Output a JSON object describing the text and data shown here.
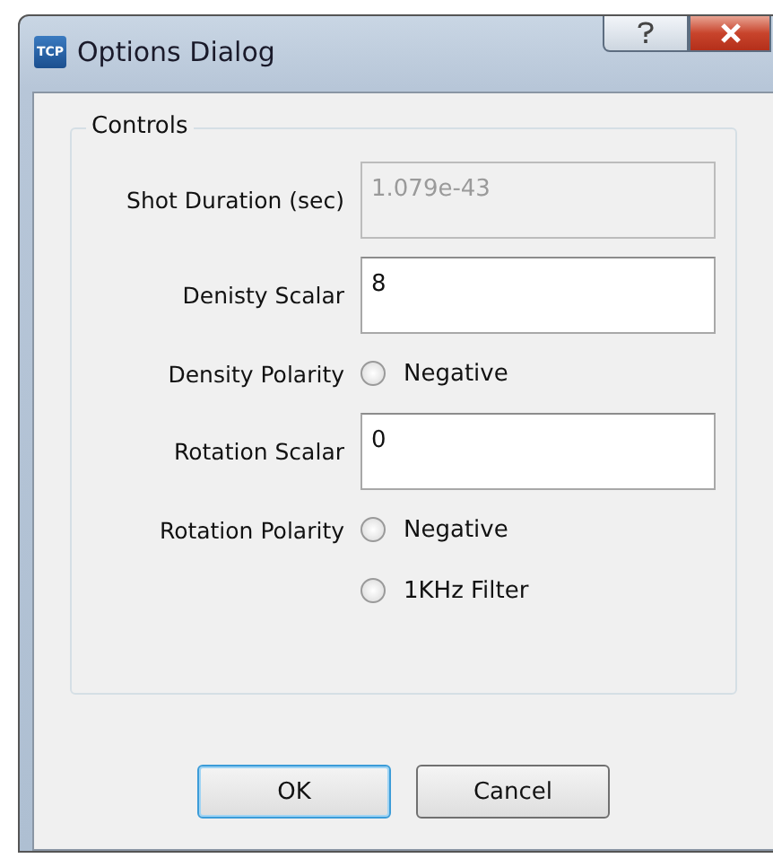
{
  "window": {
    "title": "Options Dialog",
    "icon_text": "TCP"
  },
  "group": {
    "title": "Controls"
  },
  "rows": [
    {
      "kind": "field",
      "label": "Shot Duration (sec)",
      "value": "1.079e-43",
      "disabled": true
    },
    {
      "kind": "field",
      "label": "Denisty Scalar",
      "value": "8",
      "disabled": false
    },
    {
      "kind": "radio",
      "label": "Density Polarity",
      "option": "Negative",
      "selected": false
    },
    {
      "kind": "field",
      "label": "Rotation Scalar",
      "value": "0",
      "disabled": false
    },
    {
      "kind": "radio",
      "label": "Rotation Polarity",
      "option": "Negative",
      "selected": false
    },
    {
      "kind": "radio",
      "option": "1KHz Filter",
      "selected": false
    }
  ],
  "buttons": [
    {
      "label": "OK",
      "default": true
    },
    {
      "label": "Cancel",
      "default": false
    }
  ]
}
